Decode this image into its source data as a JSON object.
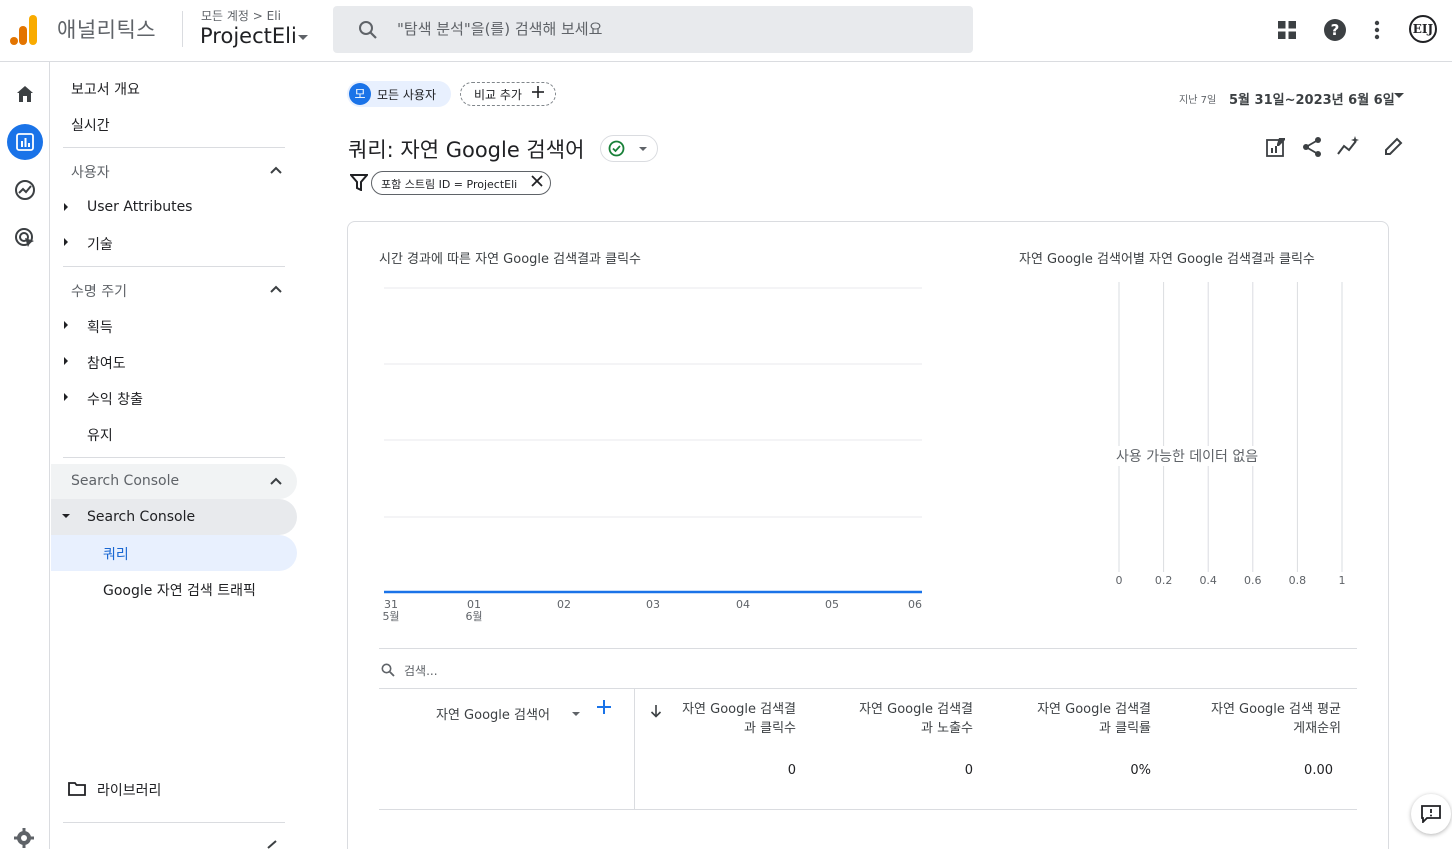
{
  "header": {
    "brand": "애널리틱스",
    "breadcrumb": "모든 계정 > Eli",
    "property": "ProjectEli",
    "search_placeholder": "\"탐색 분석\"을(를) 검색해 보세요",
    "avatar": "EIJ"
  },
  "nav": {
    "overview": "보고서 개요",
    "realtime": "실시간",
    "section_user": "사용자",
    "user_attributes": "User Attributes",
    "tech": "기술",
    "section_lifecycle": "수명 주기",
    "acquisition": "획득",
    "engagement": "참여도",
    "monetization": "수익 창출",
    "retention": "유지",
    "section_search_console": "Search Console",
    "search_console": "Search Console",
    "queries": "쿼리",
    "organic_traffic": "Google 자연 검색 트래픽",
    "library": "라이브러리"
  },
  "toolbar": {
    "all_users_badge": "모",
    "all_users": "모든 사용자",
    "add_compare": "비교 추가",
    "date_prefix": "지난 7일",
    "date_range": "5월 31일~2023년 6월 6일"
  },
  "report": {
    "title": "쿼리: 자연 Google 검색어",
    "filter": "포함 스트림 ID = ProjectEli"
  },
  "chart_data": [
    {
      "type": "line",
      "title": "시간 경과에 따른 자연 Google 검색결과 클릭수",
      "x": [
        "31\n5월",
        "01\n6월",
        "02",
        "03",
        "04",
        "05",
        "06"
      ],
      "series": [
        {
          "values": [
            0,
            0,
            0,
            0,
            0,
            0,
            0
          ]
        }
      ]
    },
    {
      "type": "bar",
      "title": "자연 Google 검색어별 자연 Google 검색결과 클릭수",
      "xticks": [
        "0",
        "0.2",
        "0.4",
        "0.6",
        "0.8",
        "1"
      ],
      "xlim": [
        0,
        1
      ],
      "empty_message": "사용 가능한 데이터 없음"
    }
  ],
  "table": {
    "search_placeholder": "검색...",
    "dimension_header": "자연 Google 검색어",
    "columns": [
      {
        "line1": "자연 Google 검색결",
        "line2": "과 클릭수"
      },
      {
        "line1": "자연 Google 검색결",
        "line2": "과 노출수"
      },
      {
        "line1": "자연 Google 검색결",
        "line2": "과 클릭률"
      },
      {
        "line1": "자연 Google 검색 평균",
        "line2": "게재순위"
      }
    ],
    "totals": [
      "0",
      "0",
      "0%",
      "0.00"
    ]
  },
  "colors": {
    "accent": "#1a73e8",
    "orange_logo": "#f9ab00",
    "dark_orange_logo": "#e37400",
    "check_green": "#188038"
  }
}
